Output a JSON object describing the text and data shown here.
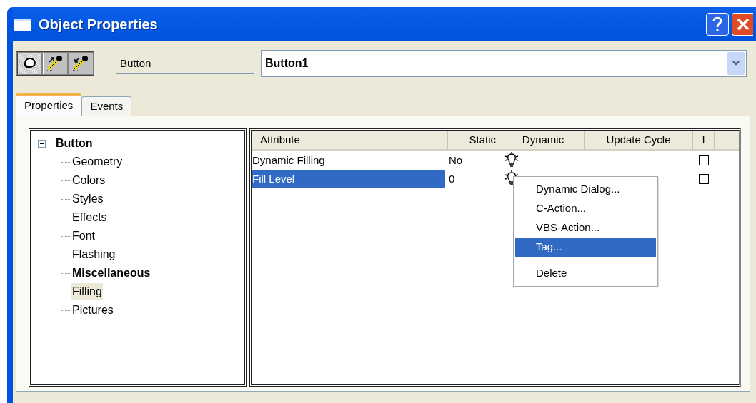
{
  "window": {
    "title": "Object Properties"
  },
  "toolbar": {
    "tools": [
      {
        "pressed": true
      },
      {
        "pressed": false
      },
      {
        "pressed": false
      }
    ],
    "object_type": "Button",
    "object_name": "Button1"
  },
  "tabs": [
    {
      "label": "Properties",
      "selected": true
    },
    {
      "label": "Events",
      "selected": false
    }
  ],
  "tree": {
    "label": "Button",
    "expanded": true,
    "children": [
      {
        "label": "Geometry",
        "bold": false,
        "selected": false
      },
      {
        "label": "Colors",
        "bold": false,
        "selected": false
      },
      {
        "label": "Styles",
        "bold": false,
        "selected": false
      },
      {
        "label": "Effects",
        "bold": false,
        "selected": false
      },
      {
        "label": "Font",
        "bold": false,
        "selected": false
      },
      {
        "label": "Flashing",
        "bold": false,
        "selected": false
      },
      {
        "label": "Miscellaneous",
        "bold": true,
        "selected": false
      },
      {
        "label": "Filling",
        "bold": false,
        "selected": true
      },
      {
        "label": "Pictures",
        "bold": false,
        "selected": false
      }
    ]
  },
  "table": {
    "columns": [
      "Attribute",
      "Static",
      "Dynamic",
      "Update Cycle",
      "I"
    ],
    "rows": [
      {
        "attribute": "Dynamic Filling",
        "static": "No",
        "selected": false,
        "checked": false
      },
      {
        "attribute": "Fill Level",
        "static": "0",
        "selected": true,
        "checked": false
      }
    ]
  },
  "context_menu": [
    {
      "label": "Dynamic Dialog...",
      "selected": false,
      "separator_before": false
    },
    {
      "label": "C-Action...",
      "selected": false,
      "separator_before": false
    },
    {
      "label": "VBS-Action...",
      "selected": false,
      "separator_before": false
    },
    {
      "label": "Tag...",
      "selected": true,
      "separator_before": false
    },
    {
      "label": "Delete",
      "selected": false,
      "separator_before": true
    }
  ]
}
